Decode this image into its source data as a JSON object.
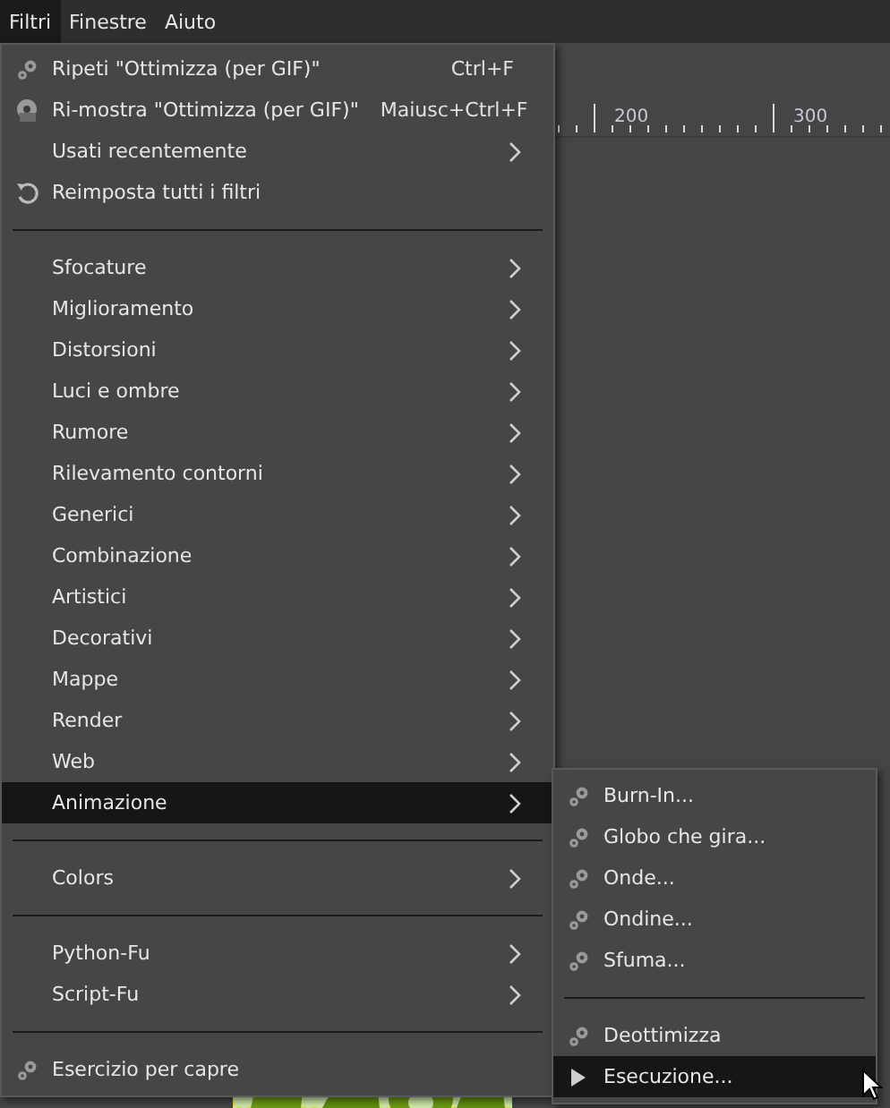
{
  "menubar": [
    {
      "label": "Filtri",
      "selected": true
    },
    {
      "label": "Finestre",
      "selected": false
    },
    {
      "label": "Aiuto",
      "selected": false
    }
  ],
  "ruler": {
    "labels": [
      "200",
      "300"
    ]
  },
  "menu": [
    {
      "kind": "repeat",
      "label": "Ripeti \"Ottimizza (per GIF)\"",
      "shortcut": "Ctrl+F",
      "selected": false
    },
    {
      "kind": "reshow",
      "label": "Ri-mostra \"Ottimizza (per GIF)\"",
      "shortcut": "Maiusc+Ctrl+F",
      "selected": false
    },
    {
      "kind": "submenu",
      "label": "Usati recentemente",
      "selected": false
    },
    {
      "kind": "reset",
      "label": "Reimposta tutti i filtri",
      "selected": false
    },
    {
      "kind": "separator"
    },
    {
      "kind": "submenu",
      "label": "Sfocature",
      "selected": false
    },
    {
      "kind": "submenu",
      "label": "Miglioramento",
      "selected": false
    },
    {
      "kind": "submenu",
      "label": "Distorsioni",
      "selected": false
    },
    {
      "kind": "submenu",
      "label": "Luci e ombre",
      "selected": false
    },
    {
      "kind": "submenu",
      "label": "Rumore",
      "selected": false
    },
    {
      "kind": "submenu",
      "label": "Rilevamento contorni",
      "selected": false
    },
    {
      "kind": "submenu",
      "label": "Generici",
      "selected": false
    },
    {
      "kind": "submenu",
      "label": "Combinazione",
      "selected": false
    },
    {
      "kind": "submenu",
      "label": "Artistici",
      "selected": false
    },
    {
      "kind": "submenu",
      "label": "Decorativi",
      "selected": false
    },
    {
      "kind": "submenu",
      "label": "Mappe",
      "selected": false
    },
    {
      "kind": "submenu",
      "label": "Render",
      "selected": false
    },
    {
      "kind": "submenu",
      "label": "Web",
      "selected": false
    },
    {
      "kind": "submenu",
      "label": "Animazione",
      "selected": true
    },
    {
      "kind": "separator"
    },
    {
      "kind": "submenu",
      "label": "Colors",
      "selected": false
    },
    {
      "kind": "separator"
    },
    {
      "kind": "submenu",
      "label": "Python-Fu",
      "selected": false
    },
    {
      "kind": "submenu",
      "label": "Script-Fu",
      "selected": false
    },
    {
      "kind": "separator"
    },
    {
      "kind": "repeat",
      "label": "Esercizio per capre",
      "selected": false
    }
  ],
  "submenu": [
    {
      "kind": "filter",
      "label": "Burn-In...",
      "selected": false
    },
    {
      "kind": "filter",
      "label": "Globo che gira...",
      "selected": false
    },
    {
      "kind": "filter",
      "label": "Onde...",
      "selected": false
    },
    {
      "kind": "filter",
      "label": "Ondine...",
      "selected": false
    },
    {
      "kind": "filter",
      "label": "Sfuma...",
      "selected": false
    },
    {
      "kind": "separator"
    },
    {
      "kind": "filter",
      "label": "Deottimizza",
      "selected": false
    },
    {
      "kind": "play",
      "label": "Esecuzione...",
      "selected": true
    }
  ]
}
